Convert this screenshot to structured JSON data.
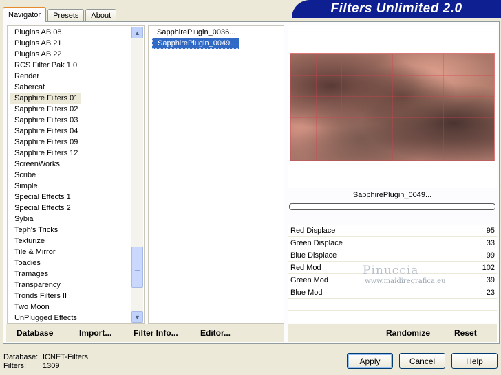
{
  "tabs": [
    "Navigator",
    "Presets",
    "About"
  ],
  "banner": "Filters Unlimited 2.0",
  "categories": [
    "Plugins AB 08",
    "Plugins AB 21",
    "Plugins AB 22",
    "RCS Filter Pak 1.0",
    "Render",
    "Sabercat",
    "Sapphire Filters 01",
    "Sapphire Filters 02",
    "Sapphire Filters 03",
    "Sapphire Filters 04",
    "Sapphire Filters 09",
    "Sapphire Filters 12",
    "ScreenWorks",
    "Scribe",
    "Simple",
    "Special Effects 1",
    "Special Effects 2",
    "Sybia",
    "Teph's Tricks",
    "Texturize",
    "Tile & Mirror",
    "Toadies",
    "Tramages",
    "Transparency",
    "Tronds Filters II",
    "Two Moon",
    "UnPlugged Effects"
  ],
  "selected_category": "Sapphire Filters 01",
  "filters": [
    "SapphirePlugin_0036...",
    "SapphirePlugin_0049..."
  ],
  "selected_filter": "SapphirePlugin_0049...",
  "preview_label": "SapphirePlugin_0049...",
  "params": [
    {
      "name": "Red Displace",
      "value": "95"
    },
    {
      "name": "Green Displace",
      "value": "33"
    },
    {
      "name": "Blue Displace",
      "value": "99"
    },
    {
      "name": "Red Mod",
      "value": "102"
    },
    {
      "name": "Green Mod",
      "value": "39"
    },
    {
      "name": "Blue Mod",
      "value": "23"
    }
  ],
  "watermark": {
    "name": "Pinuccia",
    "url": "www.maidiregrafica.eu"
  },
  "toolbar": {
    "database": "Database",
    "import": "Import...",
    "filter_info": "Filter Info...",
    "editor": "Editor...",
    "randomize": "Randomize",
    "reset": "Reset"
  },
  "status": {
    "database_label": "Database:",
    "database_value": "ICNET-Filters",
    "filters_label": "Filters:",
    "filters_value": "1309"
  },
  "buttons": {
    "apply": "Apply",
    "cancel": "Cancel",
    "help": "Help"
  },
  "colors": {
    "banner": "#0e1f92",
    "selection": "#316ac5"
  }
}
